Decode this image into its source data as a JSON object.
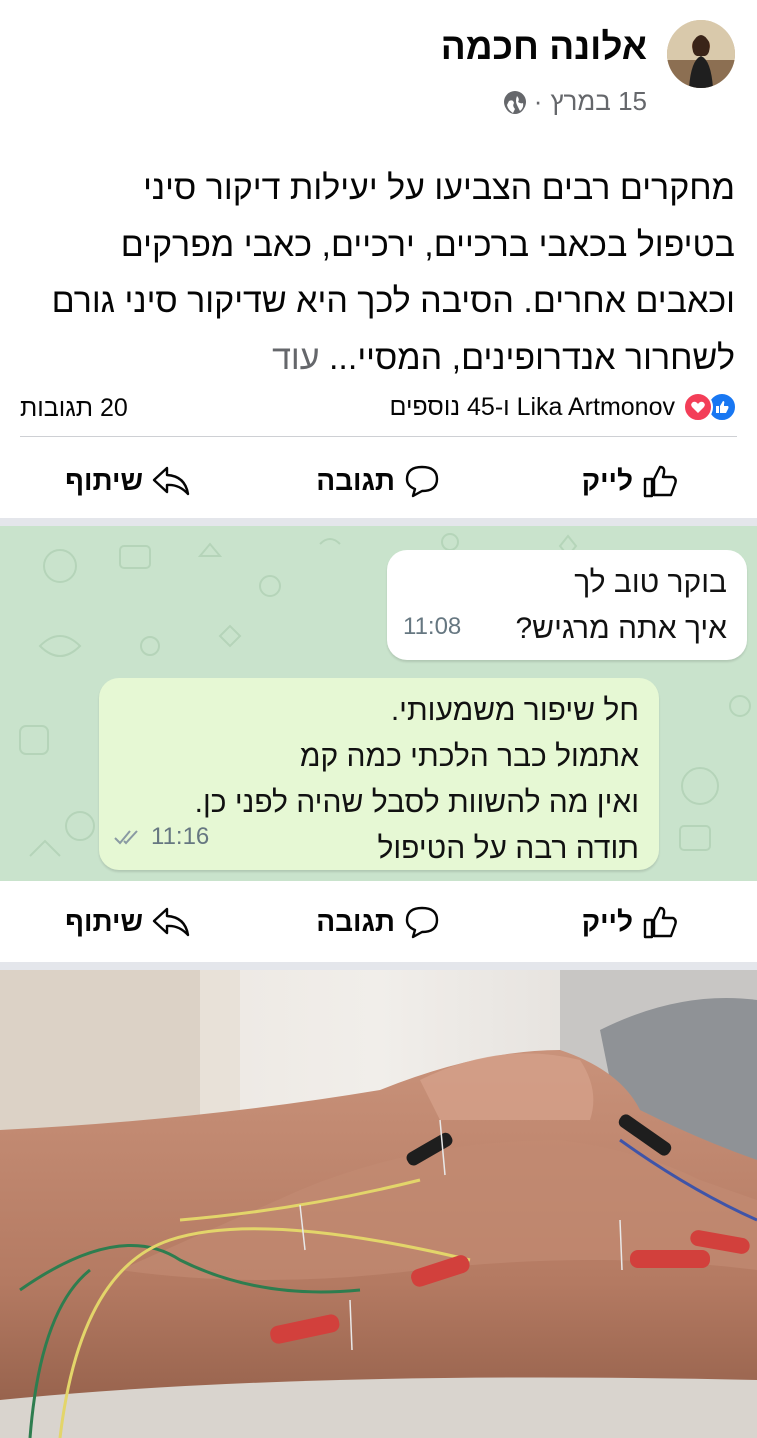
{
  "post": {
    "author": "אלונה חכמה",
    "date": "15 במרץ",
    "meta_dot": "·",
    "text": "מחקרים רבים הצביעו על יעילות דיקור סיני בטיפול בכאבי ברכיים, ירכיים, כאבי מפרקים וכאבים אחרים. הסיבה לכך היא שדיקור סיני גורם לשחרור אנדרופינים, המסיי...",
    "see_more": "עוד",
    "reactions_text": "Lika Artmonov ו-45 נוספים",
    "comments_count": "20 תגובות"
  },
  "actions": {
    "like": "לייק",
    "comment": "תגובה",
    "share": "שיתוף"
  },
  "chat": {
    "incoming": {
      "lines": [
        "בוקר טוב לך",
        "איך אתה מרגיש?"
      ],
      "time": "11:08"
    },
    "outgoing": {
      "lines": [
        "חל שיפור משמעותי.",
        "אתמול כבר הלכתי כמה קמ",
        "ואין מה להשוות לסבל שהיה לפני כן.",
        "תודה רבה על הטיפול"
      ],
      "time": "11:16"
    }
  },
  "colors": {
    "facebook_blue": "#1877f2",
    "love_red": "#f33e58",
    "chat_bg": "#c9e3cc",
    "outgoing_bubble": "#e6f8d4",
    "read_ticks": "#8a9aa3"
  },
  "icons": {
    "like": "thumbs-up-icon",
    "comment": "speech-bubble-icon",
    "share": "share-arrow-icon",
    "privacy": "globe-icon",
    "read_status": "double-check-icon"
  }
}
